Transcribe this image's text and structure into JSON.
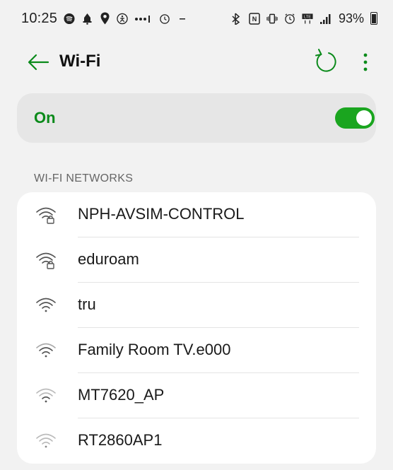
{
  "status_bar": {
    "time": "10:25",
    "battery_percent": "93%",
    "left_icons": [
      "spotify-icon",
      "notification-icon",
      "location-icon",
      "accessibility-icon",
      "more-dots-icon",
      "alarm-icon",
      "dash-icon"
    ],
    "right_icons": [
      "bluetooth-icon",
      "nfc-icon",
      "vibrate-icon",
      "alarm-icon",
      "volte-icon",
      "signal-icon",
      "battery-icon"
    ]
  },
  "header": {
    "title": "Wi-Fi",
    "back_icon": "arrow-left-icon",
    "refresh_icon": "refresh-icon",
    "more_icon": "more-vert-icon"
  },
  "wifi_toggle": {
    "label": "On",
    "enabled": true
  },
  "networks_section": {
    "title": "WI-FI NETWORKS",
    "networks": [
      {
        "name": "NPH-AVSIM-CONTROL",
        "secured": true,
        "signal": 3
      },
      {
        "name": "eduroam",
        "secured": true,
        "signal": 3
      },
      {
        "name": "tru",
        "secured": false,
        "signal": 3
      },
      {
        "name": "Family Room TV.e000",
        "secured": false,
        "signal": 2
      },
      {
        "name": "MT7620_AP",
        "secured": false,
        "signal": 1
      },
      {
        "name": "RT2860AP1",
        "secured": false,
        "signal": 1
      }
    ]
  },
  "colors": {
    "accent": "#1aa51f",
    "accent_text": "#0a8a1a",
    "background": "#f2f2f2",
    "card": "#ffffff",
    "on_card": "#e6e6e6"
  }
}
